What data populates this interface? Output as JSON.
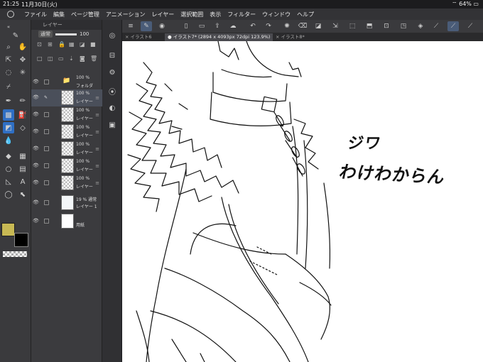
{
  "status": {
    "time": "21:25",
    "date": "11月30日(火)",
    "battery": "64%"
  },
  "menu": [
    "ファイル",
    "編集",
    "ページ管理",
    "アニメーション",
    "レイヤー",
    "選択範囲",
    "表示",
    "フィルター",
    "ウィンドウ",
    "ヘルプ"
  ],
  "layer_panel": {
    "title": "レイヤー",
    "blend_mode": "通常",
    "opacity": "100",
    "layers": [
      {
        "opacity": "100 %",
        "name": "フォルダ",
        "kind": "folder"
      },
      {
        "opacity": "100 %",
        "name": "レイヤー",
        "kind": "raster",
        "selected": true
      },
      {
        "opacity": "100 %",
        "name": "レイヤー",
        "kind": "raster"
      },
      {
        "opacity": "100 %",
        "name": "レイヤー",
        "kind": "raster"
      },
      {
        "opacity": "100 %",
        "name": "レイヤー",
        "kind": "raster"
      },
      {
        "opacity": "100 %",
        "name": "レイヤー",
        "kind": "raster"
      },
      {
        "opacity": "100 %",
        "name": "レイヤー",
        "kind": "raster"
      },
      {
        "opacity": "19 % 通常",
        "name": "レイヤー 1",
        "kind": "sketch"
      },
      {
        "opacity": "",
        "name": "用紙",
        "kind": "paper"
      }
    ]
  },
  "tabs": [
    {
      "label": "× イラスト6",
      "active": false
    },
    {
      "label": "● イラスト7* (2894 x 4093px 72dpi 123.9%)",
      "active": true
    },
    {
      "label": "× イラスト8*",
      "active": false
    }
  ],
  "canvas_text": {
    "line1": "ジワ",
    "line2": "わけわからん"
  },
  "colors": {
    "main": "#c8b954",
    "sub": "#000000",
    "accent": "#2f6fc4"
  }
}
